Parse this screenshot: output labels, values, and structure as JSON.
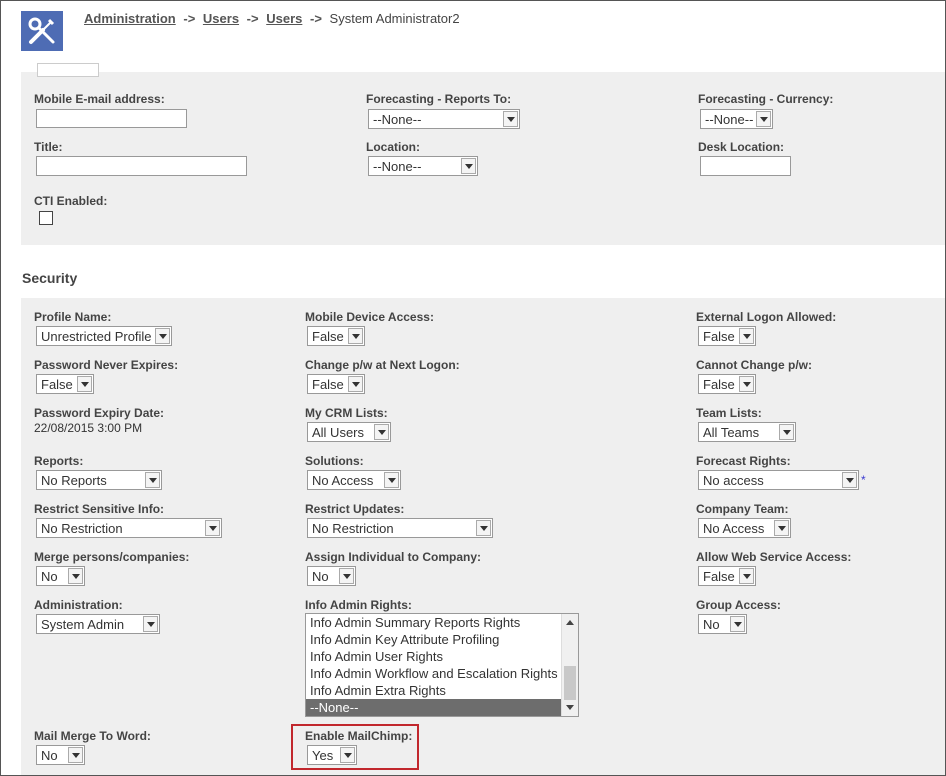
{
  "breadcrumb": {
    "items": [
      "Administration",
      "Users",
      "Users"
    ],
    "separator": "->",
    "current": "System Administrator2"
  },
  "contact": {
    "mobile_email_label": "Mobile E-mail address:",
    "mobile_email_value": "",
    "forecast_reports_to_label": "Forecasting - Reports To:",
    "forecast_reports_to_value": "--None--",
    "forecast_currency_label": "Forecasting - Currency:",
    "forecast_currency_value": "--None--",
    "title_label": "Title:",
    "title_value": "",
    "location_label": "Location:",
    "location_value": "--None--",
    "desk_location_label": "Desk Location:",
    "desk_location_value": "",
    "cti_enabled_label": "CTI Enabled:"
  },
  "security": {
    "heading": "Security",
    "profile_name_label": "Profile Name:",
    "profile_name_value": "Unrestricted Profile",
    "mobile_device_label": "Mobile Device Access:",
    "mobile_device_value": "False",
    "external_logon_label": "External Logon Allowed:",
    "external_logon_value": "False",
    "password_never_expires_label": "Password Never Expires:",
    "password_never_expires_value": "False",
    "change_pw_label": "Change p/w at Next Logon:",
    "change_pw_value": "False",
    "cannot_change_pw_label": "Cannot Change p/w:",
    "cannot_change_pw_value": "False",
    "password_expiry_label": "Password Expiry Date:",
    "password_expiry_value": "22/08/2015 3:00 PM",
    "my_crm_lists_label": "My CRM Lists:",
    "my_crm_lists_value": "All Users",
    "team_lists_label": "Team Lists:",
    "team_lists_value": "All Teams",
    "reports_label": "Reports:",
    "reports_value": "No Reports",
    "solutions_label": "Solutions:",
    "solutions_value": "No Access",
    "forecast_rights_label": "Forecast Rights:",
    "forecast_rights_value": "No access",
    "forecast_rights_marker": "*",
    "restrict_sensitive_label": "Restrict Sensitive Info:",
    "restrict_sensitive_value": "No Restriction",
    "restrict_updates_label": "Restrict Updates:",
    "restrict_updates_value": "No Restriction",
    "company_team_label": "Company Team:",
    "company_team_value": "No Access",
    "merge_label": "Merge persons/companies:",
    "merge_value": "No",
    "assign_individual_label": "Assign Individual to Company:",
    "assign_individual_value": "No",
    "allow_web_service_label": "Allow Web Service Access:",
    "allow_web_service_value": "False",
    "administration_label": "Administration:",
    "administration_value": "System Admin",
    "info_admin_rights_label": "Info Admin Rights:",
    "info_admin_rights_options": [
      "Info Admin Summary Reports Rights",
      "Info Admin Key Attribute Profiling",
      "Info Admin User Rights",
      "Info Admin Workflow and Escalation Rights",
      "Info Admin Extra Rights",
      "--None--"
    ],
    "info_admin_rights_selected": "--None--",
    "group_access_label": "Group Access:",
    "group_access_value": "No",
    "mail_merge_label": "Mail Merge To Word:",
    "mail_merge_value": "No",
    "enable_mailchimp_label": "Enable MailChimp:",
    "enable_mailchimp_value": "Yes"
  }
}
